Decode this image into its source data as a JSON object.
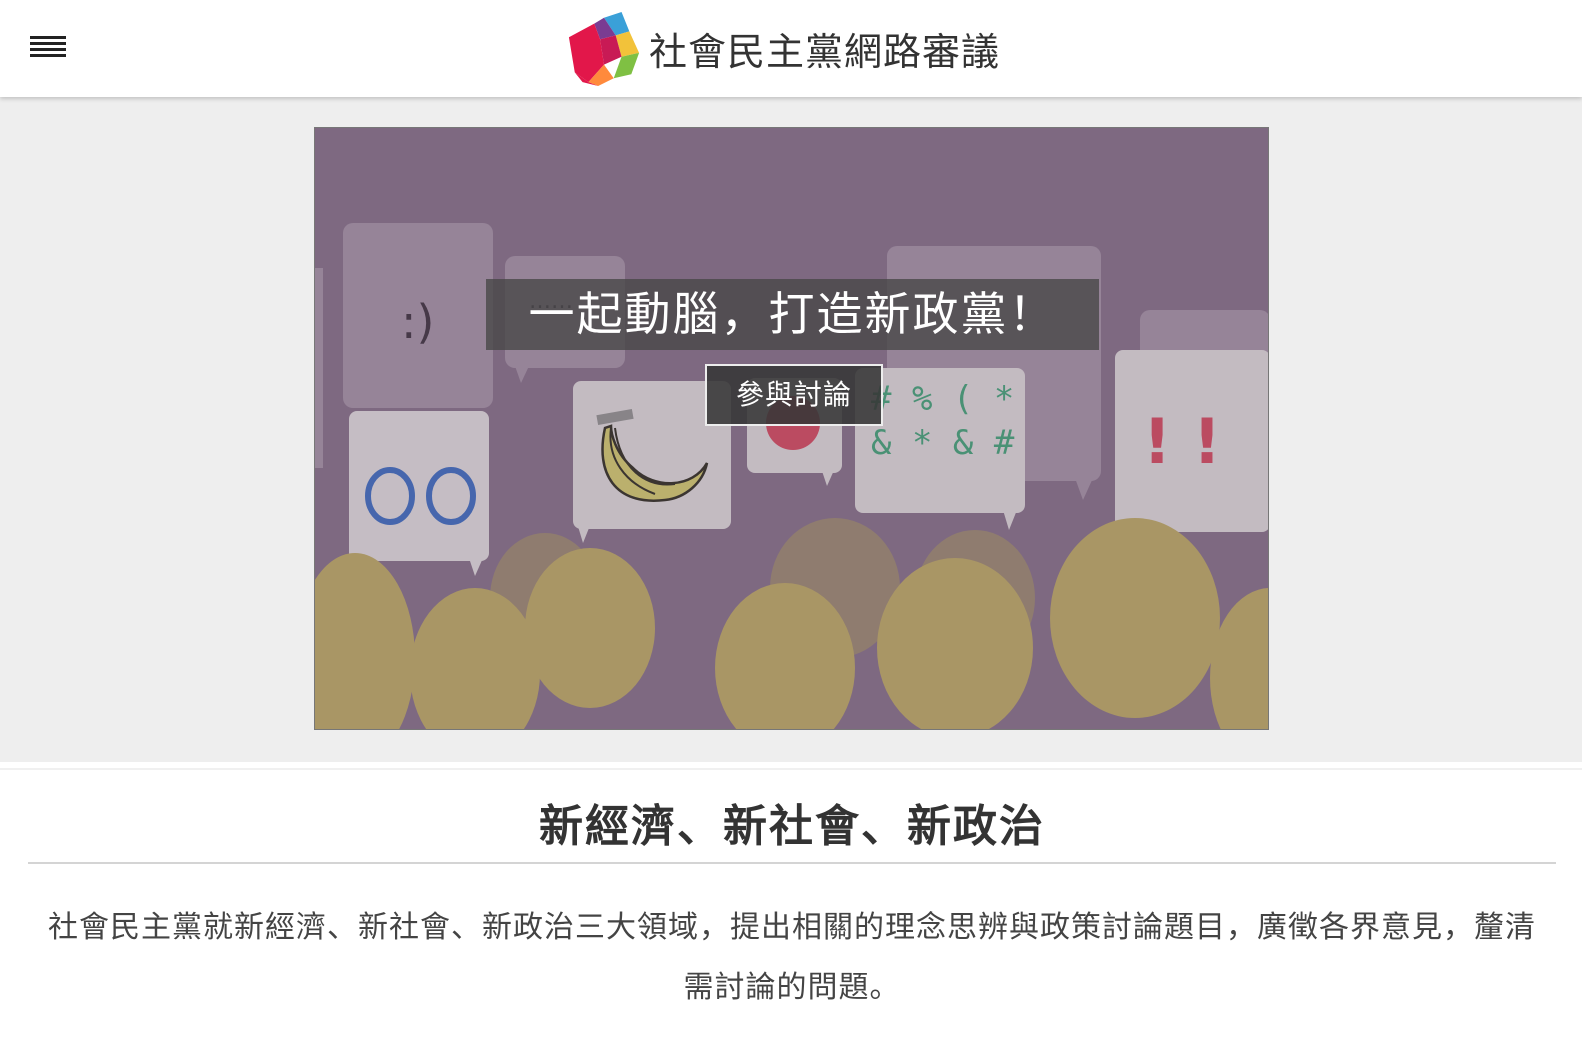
{
  "header": {
    "site_title": "社會民主黨網路審議",
    "menu_icon": "hamburger-menu-icon",
    "logo_icon": "party-logo-icon"
  },
  "hero": {
    "tagline": "一起動腦，打造新政黨！",
    "cta_label": "參與討論",
    "bubble_texts": [
      ":)",
      "……",
      "# % ( *",
      "& * & #",
      "! !"
    ],
    "colors": {
      "overlay": "#7e6a82",
      "heads": "#b3a060",
      "accent_red": "#c8455b",
      "accent_green": "#3f9a73",
      "accent_blue": "#3a66b8"
    }
  },
  "section": {
    "title": "新經濟、新社會、新政治",
    "description": "社會民主黨就新經濟、新社會、新政治三大領域，提出相關的理念思辨與政策討論題目，廣徵各界意見，釐清需討論的問題。"
  }
}
